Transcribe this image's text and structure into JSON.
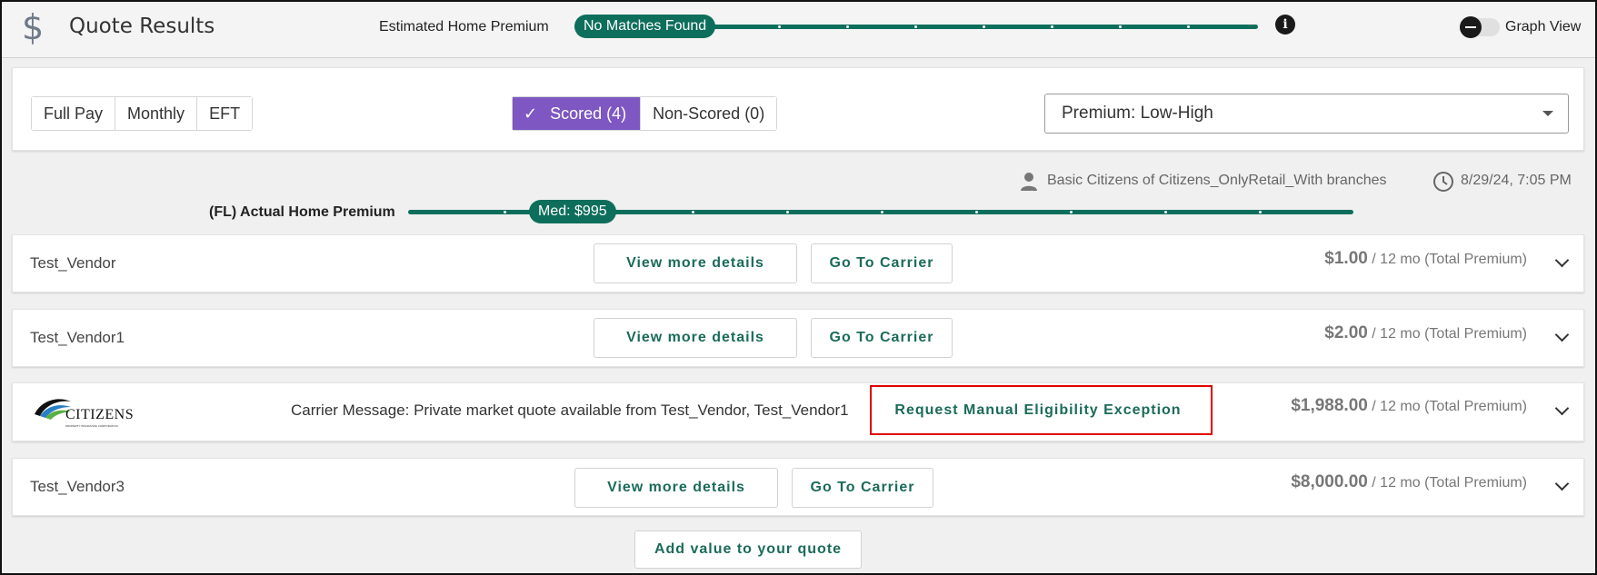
{
  "header": {
    "app_title": "Quote Results",
    "estimated_label": "Estimated Home Premium",
    "estimated_pill": "No Matches Found",
    "graph_view_label": "Graph View",
    "graph_view_on": false
  },
  "filters": {
    "pay_options": [
      "Full Pay",
      "Monthly",
      "EFT"
    ],
    "scored_label": "Scored (4)",
    "non_scored_label": "Non-Scored (0)",
    "sort_value": "Premium: Low-High"
  },
  "meta": {
    "user": "Basic Citizens of Citizens_OnlyRetail_With branches",
    "timestamp": "8/29/24, 7:05 PM"
  },
  "actual": {
    "label": "(FL) Actual Home Premium",
    "median_pill": "Med: $995"
  },
  "rows": [
    {
      "vendor": "Test_Vendor",
      "details_label": "View more details",
      "carrier_label": "Go To Carrier",
      "amount": "$1.00",
      "term": " / 12 mo (Total Premium)"
    },
    {
      "vendor": "Test_Vendor1",
      "details_label": "View more details",
      "carrier_label": "Go To Carrier",
      "amount": "$2.00",
      "term": " / 12 mo (Total Premium)"
    },
    {
      "vendor_logo_text": "CITIZENS",
      "vendor_logo_tagline": "PROPERTY INSURANCE CORPORATION",
      "carrier_message": "Carrier Message: Private market quote available from Test_Vendor, Test_Vendor1",
      "exception_label": "Request Manual Eligibility Exception",
      "amount": "$1,988.00",
      "term": " / 12 mo (Total Premium)"
    },
    {
      "vendor": "Test_Vendor3",
      "details_label": "View more details",
      "carrier_label": "Go To Carrier",
      "amount": "$8,000.00",
      "term": " / 12 mo (Total Premium)"
    }
  ],
  "add_value_label": "Add value to your quote",
  "colors": {
    "accent": "#0e6e5c",
    "scored_active": "#7e57c2",
    "highlight": "#e00000"
  }
}
